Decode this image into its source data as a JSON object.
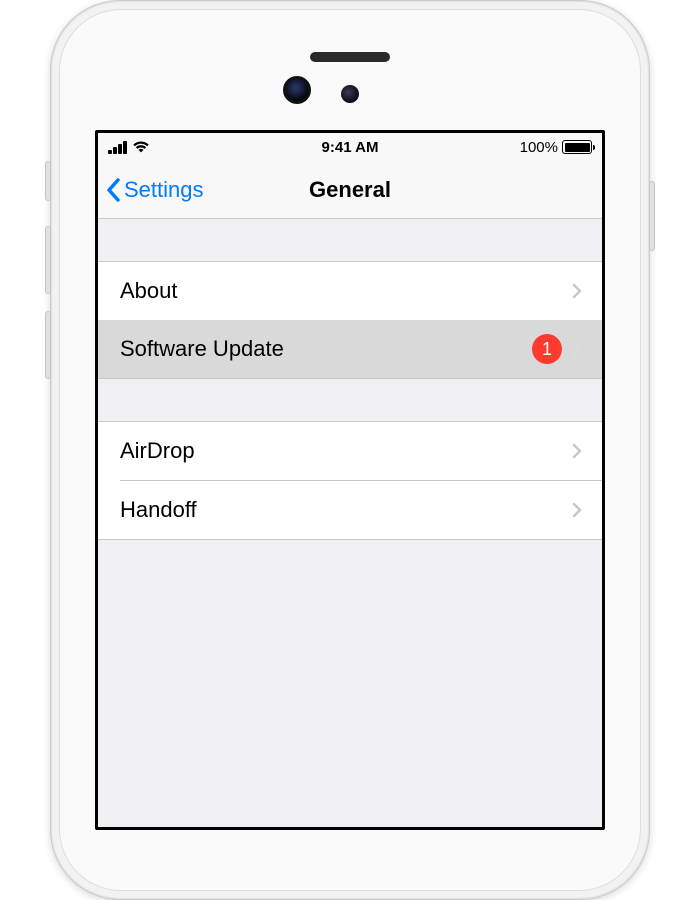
{
  "status_bar": {
    "time": "9:41 AM",
    "battery_pct": "100%"
  },
  "nav": {
    "back_label": "Settings",
    "title": "General"
  },
  "groups": [
    {
      "items": [
        {
          "label": "About",
          "badge": null,
          "highlighted": false
        },
        {
          "label": "Software Update",
          "badge": "1",
          "highlighted": true
        }
      ]
    },
    {
      "items": [
        {
          "label": "AirDrop",
          "badge": null,
          "highlighted": false
        },
        {
          "label": "Handoff",
          "badge": null,
          "highlighted": false
        }
      ]
    }
  ]
}
